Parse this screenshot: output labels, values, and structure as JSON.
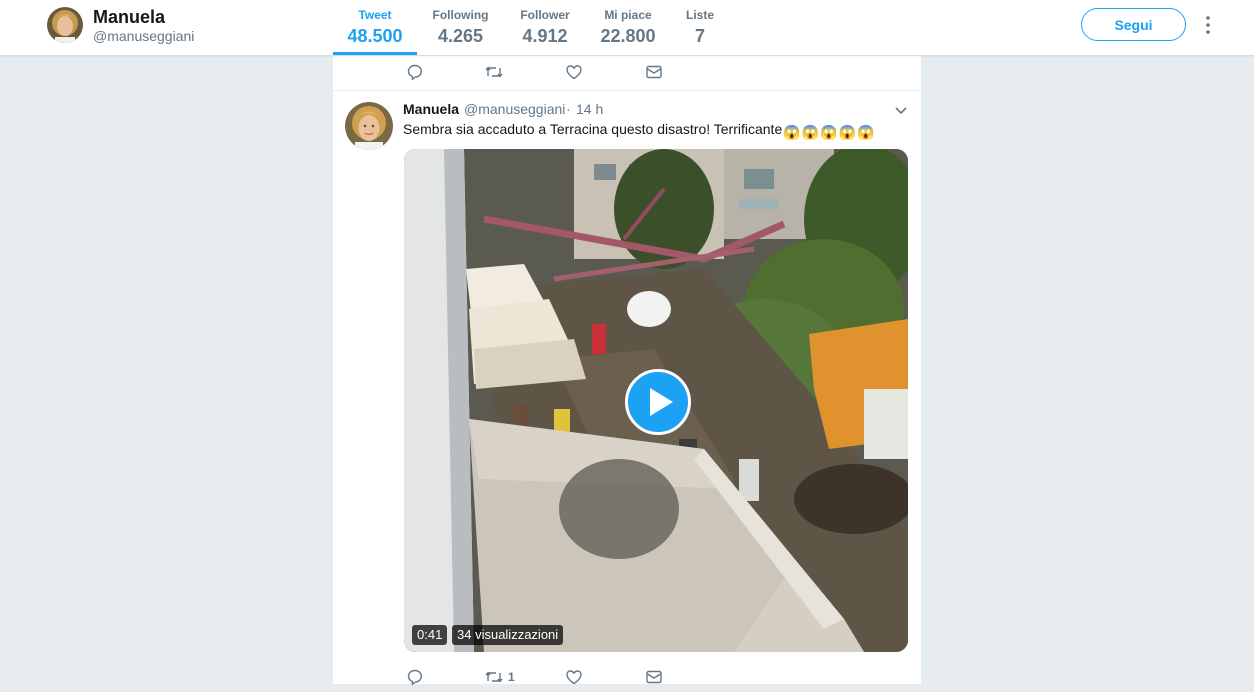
{
  "profile": {
    "name": "Manuela",
    "handle": "@manuseggiani",
    "stats": [
      {
        "label": "Tweet",
        "value": "48.500"
      },
      {
        "label": "Following",
        "value": "4.265"
      },
      {
        "label": "Follower",
        "value": "4.912"
      },
      {
        "label": "Mi piace",
        "value": "22.800"
      },
      {
        "label": "Liste",
        "value": "7"
      }
    ],
    "follow_label": "Segui"
  },
  "tweet": {
    "name": "Manuela",
    "handle": "@manuseggiani",
    "separator": "·",
    "time": "14 h",
    "text": "Sembra sia accaduto a Terracina questo disastro! Terrificante",
    "emoji": [
      "😱",
      "😱",
      "😱",
      "😱",
      "😱"
    ],
    "video": {
      "duration": "0:41",
      "views": "34 visualizzazioni"
    },
    "actions": {
      "retweet_count": "1"
    }
  },
  "colors": {
    "accent": "#1da1f2",
    "muted_text": "#657786",
    "background": "#e6ecf0"
  },
  "icons": {
    "reply": "reply-icon",
    "retweet": "retweet-icon",
    "like": "heart-icon",
    "message": "envelope-icon",
    "more": "more-vertical-icon",
    "caret": "chevron-down-icon",
    "play": "play-icon"
  }
}
